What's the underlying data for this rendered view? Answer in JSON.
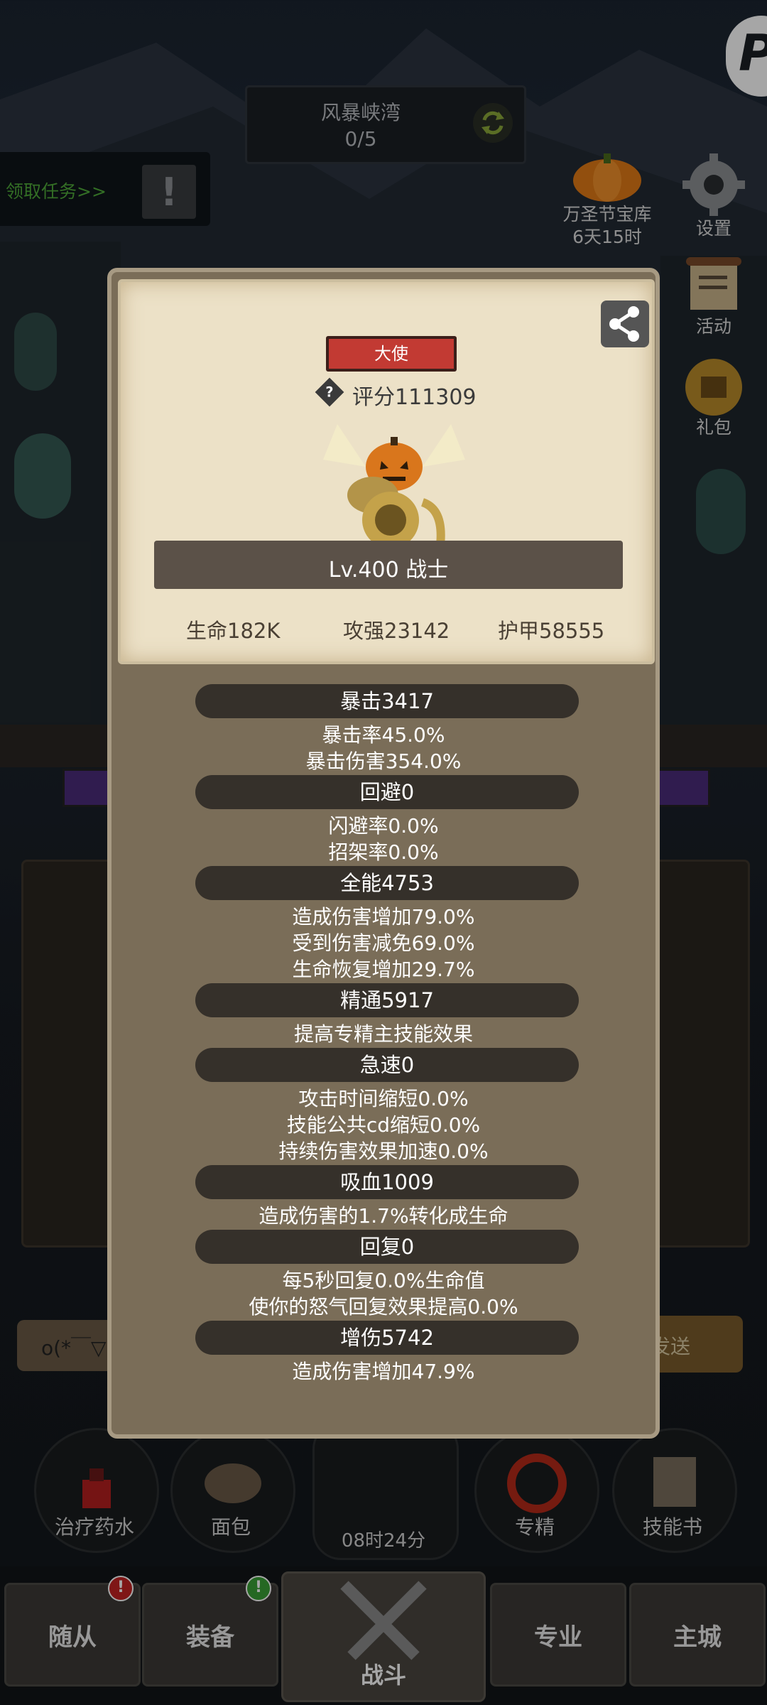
{
  "top_area": {
    "name": "风暴峡湾",
    "progress": "0/5"
  },
  "quest": {
    "label": "领取任务>>"
  },
  "side_buttons": [
    {
      "label": "万圣节宝库",
      "sub": "6天15时"
    },
    {
      "label": "设置"
    },
    {
      "label": "活动"
    },
    {
      "label": "礼包"
    }
  ],
  "hero_card": {
    "title": "大使",
    "score_label": "评分111309",
    "help_icon": "?",
    "level_class": "Lv.400 战士",
    "base_stats": [
      "生命182K",
      "攻强23142",
      "护甲58555"
    ]
  },
  "stats": [
    {
      "header": "暴击3417",
      "lines": [
        "暴击率45.0%",
        "暴击伤害354.0%"
      ]
    },
    {
      "header": "回避0",
      "lines": [
        "闪避率0.0%",
        "招架率0.0%"
      ]
    },
    {
      "header": "全能4753",
      "lines": [
        "造成伤害增加79.0%",
        "受到伤害减免69.0%",
        "生命恢复增加29.7%"
      ]
    },
    {
      "header": "精通5917",
      "lines": [
        "提高专精主技能效果"
      ]
    },
    {
      "header": "急速0",
      "lines": [
        "攻击时间缩短0.0%",
        "技能公共cd缩短0.0%",
        "持续伤害效果加速0.0%"
      ]
    },
    {
      "header": "吸血1009",
      "lines": [
        "造成伤害的1.7%转化成生命"
      ]
    },
    {
      "header": "回复0",
      "lines": [
        "每5秒回复0.0%生命值",
        "使你的怒气回复效果提高0.0%"
      ]
    },
    {
      "header": "增伤5742",
      "lines": [
        "造成伤害增加47.9%"
      ]
    }
  ],
  "chat": {
    "left": "o(*￣▽",
    "right": "发送"
  },
  "items": [
    "治疗药水",
    "面包",
    "",
    "专精",
    "技能书"
  ],
  "timer": "08时24分",
  "nav": [
    "随从",
    "装备",
    "战斗",
    "专业",
    "主城"
  ],
  "badges": {
    "followers": "!",
    "equipment": "!"
  }
}
